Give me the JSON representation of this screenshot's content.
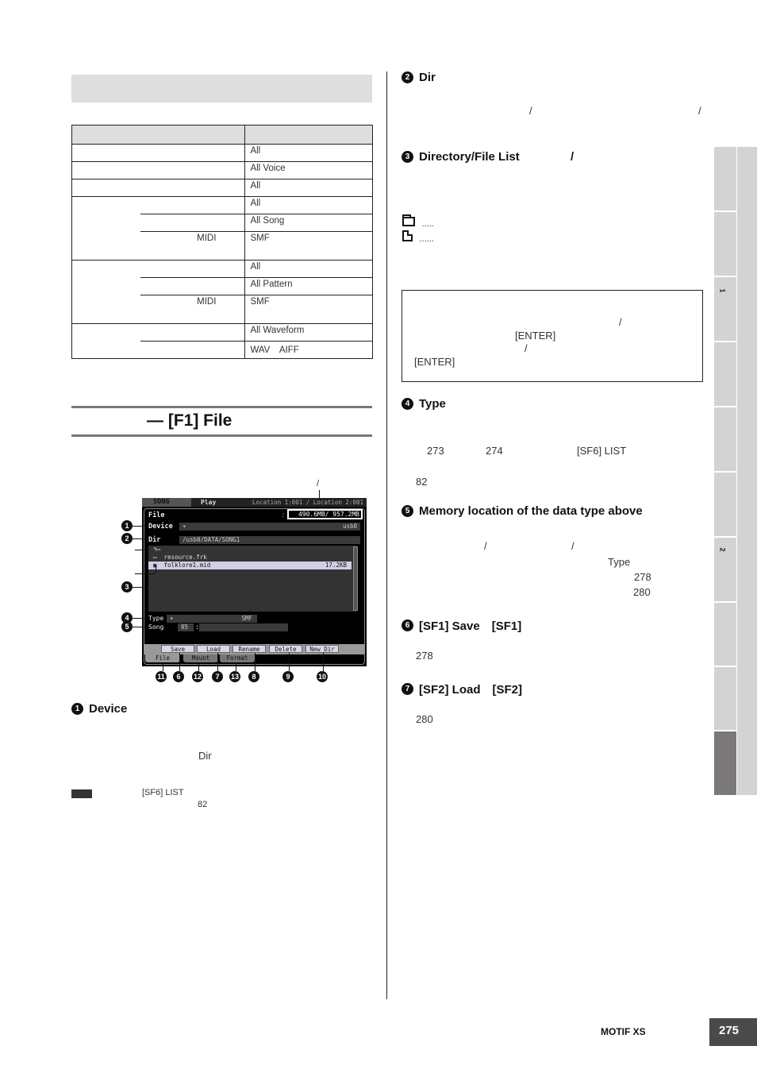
{
  "table": {
    "header": [
      "",
      ""
    ],
    "rows": [
      {
        "group": "",
        "sub": "",
        "value": "All"
      },
      {
        "group": "",
        "sub": "",
        "value": "All Voice"
      },
      {
        "group": "",
        "sub": "",
        "value": "All"
      },
      {
        "group": "",
        "sub": "",
        "value": "All"
      },
      {
        "group": "",
        "sub": "",
        "value": "All Song"
      },
      {
        "group": "",
        "sub": "MIDI",
        "value": "SMF"
      },
      {
        "group": "",
        "sub": "",
        "value": "All"
      },
      {
        "group": "",
        "sub": "",
        "value": "All Pattern"
      },
      {
        "group": "",
        "sub": "MIDI",
        "value": "SMF"
      },
      {
        "group": "",
        "sub": "",
        "value": "All Waveform"
      },
      {
        "group": "",
        "sub": "",
        "value": "WAV　AIFF"
      }
    ]
  },
  "section": {
    "title": "— [F1] File"
  },
  "screen": {
    "caption_slash": "/",
    "mode_tab": "SONG",
    "play_label": "Play",
    "location": "Location 1:001 / Location 2:001",
    "file_label": "File",
    "colon": ":",
    "memory": "490.6MB/  957.2MB",
    "device_label": "Device",
    "device_value": "usb0",
    "dir_label": "Dir",
    "dir_value": "/usb0/DATA/SONG1",
    "up_dir": "↰▭",
    "list": [
      {
        "icon": "folder",
        "name": "resource.frk",
        "size": ""
      },
      {
        "icon": "file",
        "name": "folklore1.mid",
        "size": "17.2KB",
        "selected": true
      }
    ],
    "type_label": "Type",
    "type_value": "SMF",
    "song_label": "Song",
    "song_number": "05",
    "song_sep": ":",
    "sub_buttons": [
      "Save",
      "Load",
      "Rename",
      "Delete",
      "New Dir"
    ],
    "tabs": [
      "File",
      "Mount",
      "Format"
    ],
    "callouts": [
      "1",
      "2",
      "3",
      "4",
      "5"
    ],
    "bottom_callouts": [
      "11",
      "6",
      "12",
      "7",
      "13",
      "8",
      "9",
      "10"
    ]
  },
  "left_items": {
    "device": {
      "num": "1",
      "title": "Device",
      "body_ref": "Dir"
    },
    "note": {
      "ref": "[SF6] LIST",
      "page": "82"
    }
  },
  "right_items": {
    "dir": {
      "num": "2",
      "title": "Dir",
      "slash1": "/",
      "slash2": "/"
    },
    "dirlist": {
      "num": "3",
      "title": "Directory/File List",
      "slash": "/",
      "folder_dots": ".....",
      "file_dots": "......"
    },
    "box": {
      "slash1": "/",
      "enter1": "[ENTER]",
      "slash2": "/",
      "enter2": "[ENTER]"
    },
    "type": {
      "num": "4",
      "title": "Type",
      "p1": "273",
      "p2": "274",
      "ref": "[SF6] LIST",
      "page": "82"
    },
    "memloc": {
      "num": "5",
      "title": "Memory location of the data type above",
      "slash1": "/",
      "slash2": "/",
      "type_ref": "Type",
      "p1": "278",
      "p2": "280"
    },
    "save": {
      "num": "6",
      "title": "[SF1] Save　[SF1]",
      "page": "278"
    },
    "load": {
      "num": "7",
      "title": "[SF2] Load　[SF2]",
      "page": "280"
    }
  },
  "side_tabs": {
    "labels": [
      "",
      "",
      "1",
      "",
      "",
      "",
      "2",
      "",
      "",
      ""
    ],
    "active_index": 9
  },
  "footer": {
    "brand": "MOTIF XS",
    "page": "275"
  }
}
